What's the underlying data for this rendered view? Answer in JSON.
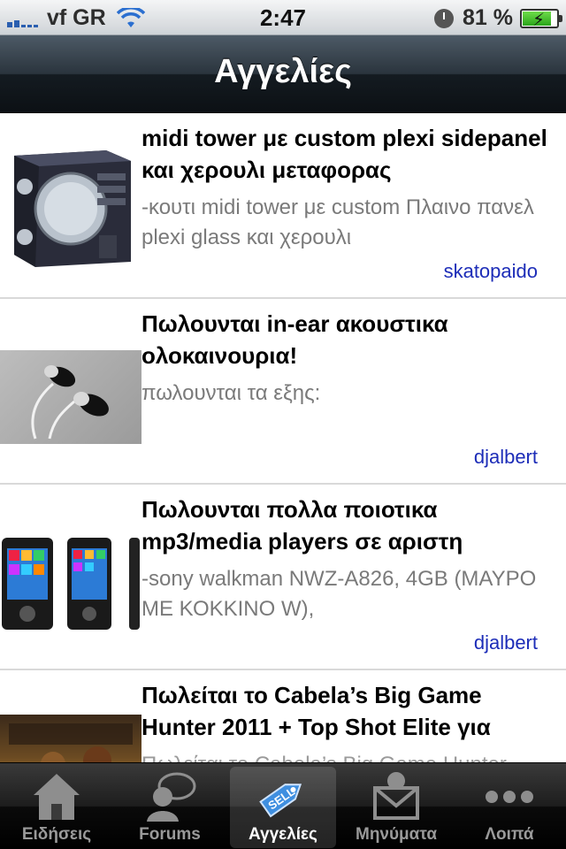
{
  "status_bar": {
    "carrier": "vf GR",
    "time": "2:47",
    "battery": "81 %"
  },
  "nav": {
    "title": "Αγγελίες"
  },
  "listings": [
    {
      "title": "midi tower με custom plexi sidepanel και χερουλι μεταφορας",
      "description": "-κουτι midi tower με custom Πλαινο πανελ plexi glass και χερουλι",
      "author": "skatopaido"
    },
    {
      "title": "Πωλουνται in-ear ακουστικα ολοκαινουρια!",
      "description": "πωλουνται τα εξης:",
      "author": "djalbert"
    },
    {
      "title": "Πωλουνται πολλα ποιοτικα mp3/media players σε αριστη",
      "description": "-sony walkman NWZ-A826, 4GB (ΜΑΥΡΟ ΜΕ ΚΟΚΚΙΝΟ W),",
      "author": "djalbert"
    },
    {
      "title": "Πωλείται το Cabela’s Big Game Hunter 2011 + Top Shot Elite για",
      "description": "Πωλείται το Cabela’s Big Game Hunter",
      "author": ""
    }
  ],
  "tabs": [
    {
      "label": "Ειδήσεις",
      "icon": "house-icon"
    },
    {
      "label": "Forums",
      "icon": "chat-user-icon"
    },
    {
      "label": "Αγγελίες",
      "icon": "sell-tag-icon",
      "badge": "SELL",
      "active": true
    },
    {
      "label": "Μηνύματα",
      "icon": "envelope-icon"
    },
    {
      "label": "Λοιπά",
      "icon": "more-dots-icon"
    }
  ],
  "colors": {
    "author_link": "#1d2db8",
    "nav_bg": "#1b232a",
    "tab_active": "#ffffff",
    "tab_inactive": "#9a9a9a"
  }
}
